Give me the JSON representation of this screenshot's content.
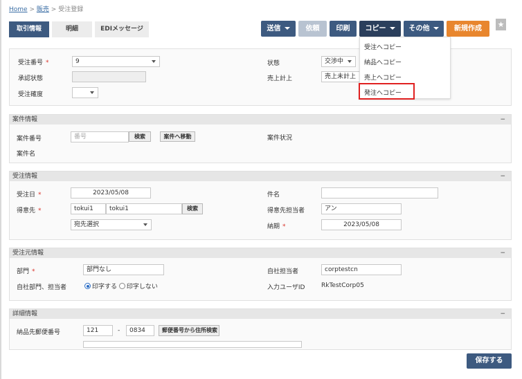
{
  "breadcrumb": {
    "home": "Home",
    "sales": "販売",
    "current": "受注登録",
    "sep": ">"
  },
  "tabs": [
    "取引情報",
    "明細",
    "EDIメッセージ"
  ],
  "toolbar": {
    "send": "送信",
    "request": "依頼",
    "print": "印刷",
    "copy": "コピー",
    "other": "その他",
    "new": "新規作成"
  },
  "copy_menu": [
    "受注へコピー",
    "納品へコピー",
    "売上へコピー",
    "発注へコピー"
  ],
  "colors": {
    "navy": "#3d5a80",
    "dark_navy": "#2b3f5c",
    "orange": "#e8862e",
    "highlight": "#e02020",
    "required": "#d9342b"
  },
  "header_form": {
    "order_no_label": "受注番号",
    "order_no": "9",
    "approval_label": "承認状態",
    "certainty_label": "受注確度",
    "status_label": "状態",
    "status": "交渉中",
    "sales_post_label": "売上計上",
    "sales_post": "売上未計上"
  },
  "project": {
    "title": "案件情報",
    "collapse": "−",
    "no_label": "案件番号",
    "no_placeholder": "番号",
    "search": "検索",
    "goto": "案件へ移動",
    "name_label": "案件名",
    "status_label": "案件状況"
  },
  "order": {
    "title": "受注情報",
    "collapse": "−",
    "date_label": "受注日",
    "date": "2023/05/08",
    "customer_label": "得意先",
    "customer_code": "tokui1",
    "customer_name": "tokui1",
    "search": "検索",
    "dest_select": "宛先選択",
    "subject_label": "件名",
    "subject": "",
    "contact_label": "得意先担当者",
    "contact": "アン",
    "due_label": "納期",
    "due": "2023/05/08"
  },
  "source": {
    "title": "受注元情報",
    "collapse": "−",
    "dept_label": "部門",
    "dept": "部門なし",
    "print_label": "自社部門、担当者",
    "opt_print": "印字する",
    "opt_noprint": "印字しない",
    "staff_label": "自社担当者",
    "staff": "corptestcn",
    "user_label": "入力ユーザID",
    "user": "RkTestCorp05"
  },
  "detail": {
    "title": "詳細情報",
    "collapse": "−",
    "zip_label": "納品先郵便番号",
    "zip1": "121",
    "zip_dash": "-",
    "zip2": "0834",
    "zip_search": "郵便番号から住所検索"
  },
  "save": "保存する"
}
